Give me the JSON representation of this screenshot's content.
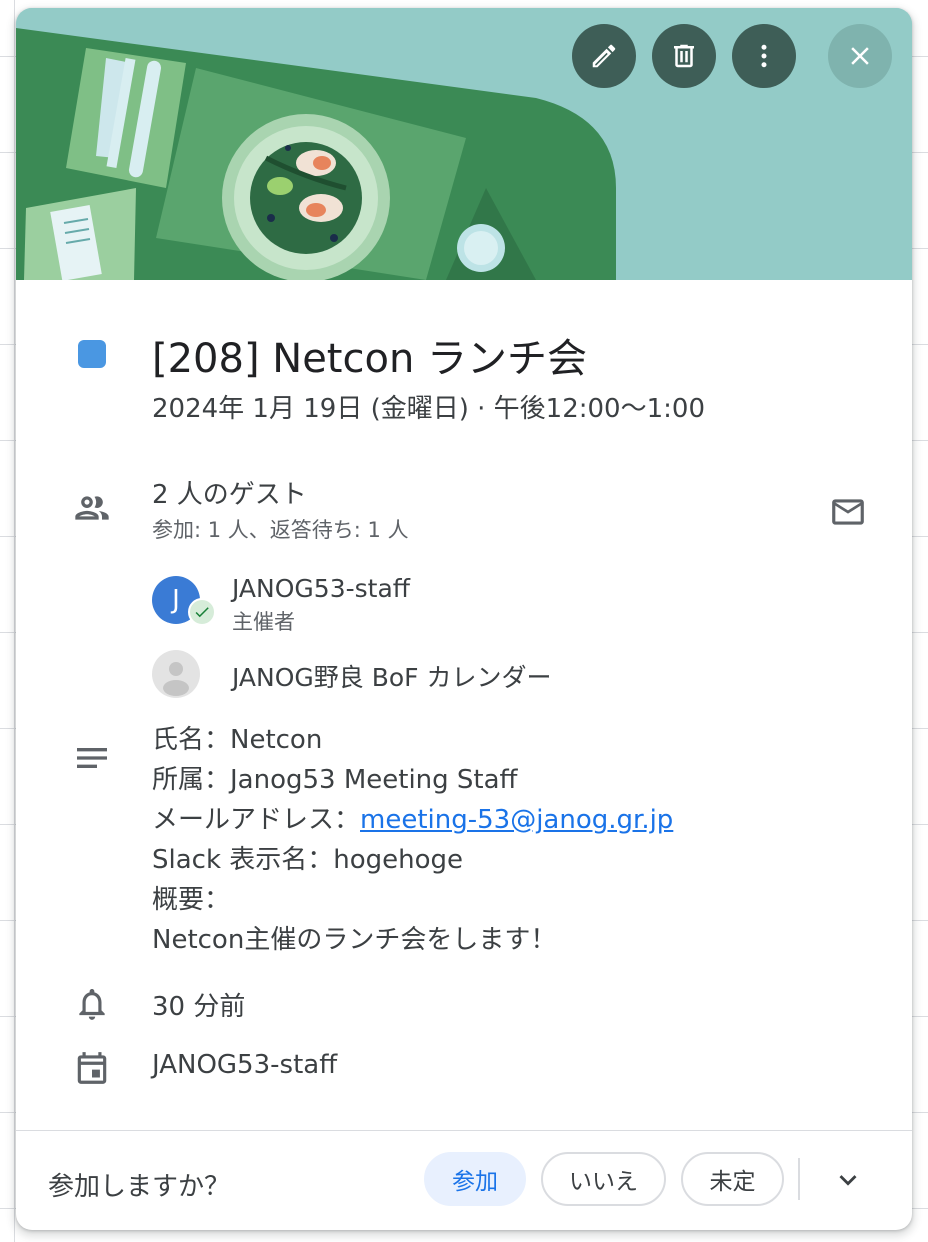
{
  "header": {
    "edit_icon": "pencil-icon",
    "delete_icon": "trash-icon",
    "more_icon": "more-vert-icon",
    "close_icon": "close-icon"
  },
  "event": {
    "color": "#4a97e2",
    "title": "[208] Netcon ランチ会",
    "datetime": "2024年 1月 19日 (金曜日)  ·  午後12:00〜1:00"
  },
  "guests": {
    "title": "2 人のゲスト",
    "summary": "参加: 1 人、返答待ち: 1 人",
    "list": [
      {
        "initial": "J",
        "name": "JANOG53-staff",
        "role": "主催者",
        "status": "accepted"
      },
      {
        "name": "JANOG野良 BoF カレンダー"
      }
    ]
  },
  "description": {
    "line1": "氏名：Netcon",
    "line2": "所属：Janog53 Meeting Staff",
    "line3_prefix": "メールアドレス：",
    "line3_link": "meeting-53@janog.gr.jp",
    "line4": "Slack 表示名：hogehoge",
    "line5": "概要：",
    "line6": "Netcon主催のランチ会をします！"
  },
  "reminder": "30 分前",
  "calendar": "JANOG53-staff",
  "rsvp": {
    "question": "参加しますか？",
    "yes": "参加",
    "no": "いいえ",
    "maybe": "未定",
    "selected": "yes"
  },
  "colors": {
    "accent": "#1a73e8",
    "hero_bg": "#93cbc7",
    "header_button": "#3e5e57"
  }
}
